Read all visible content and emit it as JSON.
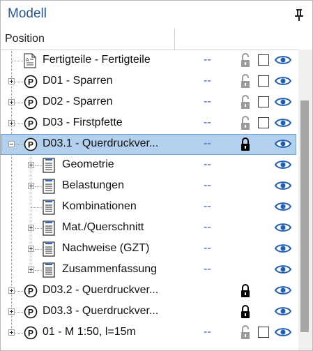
{
  "panel": {
    "title": "Modell"
  },
  "columns": {
    "position": "Position",
    "second": ""
  },
  "rows": [
    {
      "label": "Fertigteile - Fertigteile",
      "value": "--",
      "lock": "open",
      "checkbox": true,
      "eye": true
    },
    {
      "label": "D01 - Sparren",
      "value": "--",
      "lock": "open",
      "checkbox": true,
      "eye": true
    },
    {
      "label": "D02 - Sparren",
      "value": "--",
      "lock": "open",
      "checkbox": true,
      "eye": true
    },
    {
      "label": "D03 - Firstpfette",
      "value": "--",
      "lock": "open",
      "checkbox": true,
      "eye": true
    },
    {
      "label": "D03.1 - Querdruckver...",
      "value": "--",
      "lock": "closed",
      "checkbox": false,
      "eye": true,
      "selected": true,
      "expanded": true
    },
    {
      "label": "Geometrie",
      "value": "--",
      "eye": true
    },
    {
      "label": "Belastungen",
      "value": "--",
      "eye": true
    },
    {
      "label": "Kombinationen",
      "value": "--",
      "eye": true
    },
    {
      "label": "Mat./Querschnitt",
      "value": "--",
      "eye": true
    },
    {
      "label": "Nachweise (GZT)",
      "value": "--",
      "eye": true
    },
    {
      "label": "Zusammenfassung",
      "value": "--",
      "eye": true
    },
    {
      "label": "D03.2 - Querdruckver...",
      "value": "",
      "lock": "closed",
      "checkbox": false,
      "eye": true
    },
    {
      "label": "D03.3 - Querdruckver...",
      "value": "",
      "lock": "closed",
      "checkbox": false,
      "eye": true
    },
    {
      "label": "01 - M 1:50, l=15m",
      "value": "--",
      "lock": "open",
      "checkbox": true,
      "eye": true
    }
  ],
  "colors": {
    "title": "#2b579a",
    "selection": "#b3d1ef",
    "dash": "#2e57c8",
    "eye": "#1f5fb4"
  }
}
